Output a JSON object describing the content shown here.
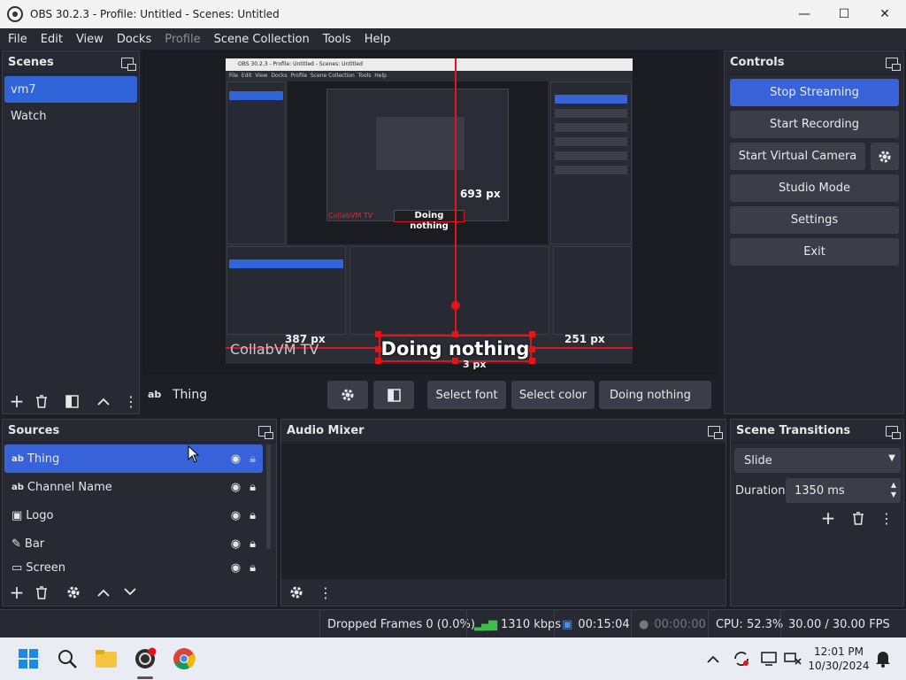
{
  "window": {
    "title": "OBS 30.2.3 - Profile: Untitled - Scenes: Untitled"
  },
  "menu": [
    "File",
    "Edit",
    "View",
    "Docks",
    "Profile",
    "Scene Collection",
    "Tools",
    "Help"
  ],
  "scenes": {
    "title": "Scenes",
    "items": [
      "vm7",
      "Watch"
    ],
    "selected_index": 0
  },
  "preview": {
    "watermark": "CollabVM TV",
    "selected_text": "Doing nothing",
    "dim_left": "387 px",
    "dim_right": "251 px",
    "dim_bottom": "3 px",
    "inner_dim_top": "693 px",
    "inner_titlebar": "OBS 30.2.3 - Profile: Untitled - Scenes: Untitled",
    "inner_menu": [
      "File",
      "Edit",
      "View",
      "Docks",
      "Profile",
      "Scene Collection",
      "Tools",
      "Help"
    ]
  },
  "source_toolbar": {
    "source_name": "Thing",
    "select_font": "Select font",
    "select_color": "Select color",
    "text_value": "Doing nothing"
  },
  "controls": {
    "title": "Controls",
    "stop_streaming": "Stop Streaming",
    "start_recording": "Start Recording",
    "start_virtual_camera": "Start Virtual Camera",
    "studio_mode": "Studio Mode",
    "settings": "Settings",
    "exit": "Exit"
  },
  "sources": {
    "title": "Sources",
    "items": [
      {
        "name": "Thing",
        "type_icon": "text-icon"
      },
      {
        "name": "Channel Name",
        "type_icon": "text-icon"
      },
      {
        "name": "Logo",
        "type_icon": "image-icon"
      },
      {
        "name": "Bar",
        "type_icon": "brush-icon"
      },
      {
        "name": "Screen",
        "type_icon": "monitor-icon"
      }
    ]
  },
  "audio_mixer": {
    "title": "Audio Mixer"
  },
  "transitions": {
    "title": "Scene Transitions",
    "selected": "Slide",
    "duration_label": "Duration",
    "duration_value": "1350 ms"
  },
  "status": {
    "dropped_frames": "Dropped Frames 0 (0.0%)",
    "bitrate": "1310 kbps",
    "stream_time": "00:15:04",
    "record_time": "00:00:00",
    "cpu": "CPU: 52.3%",
    "fps": "30.00 / 30.00 FPS"
  },
  "taskbar": {
    "time": "12:01 PM",
    "date": "10/30/2024"
  },
  "colors": {
    "accent": "#3863d8",
    "bg": "#1d1f26",
    "panel": "#272a33",
    "red": "#e0161b"
  }
}
